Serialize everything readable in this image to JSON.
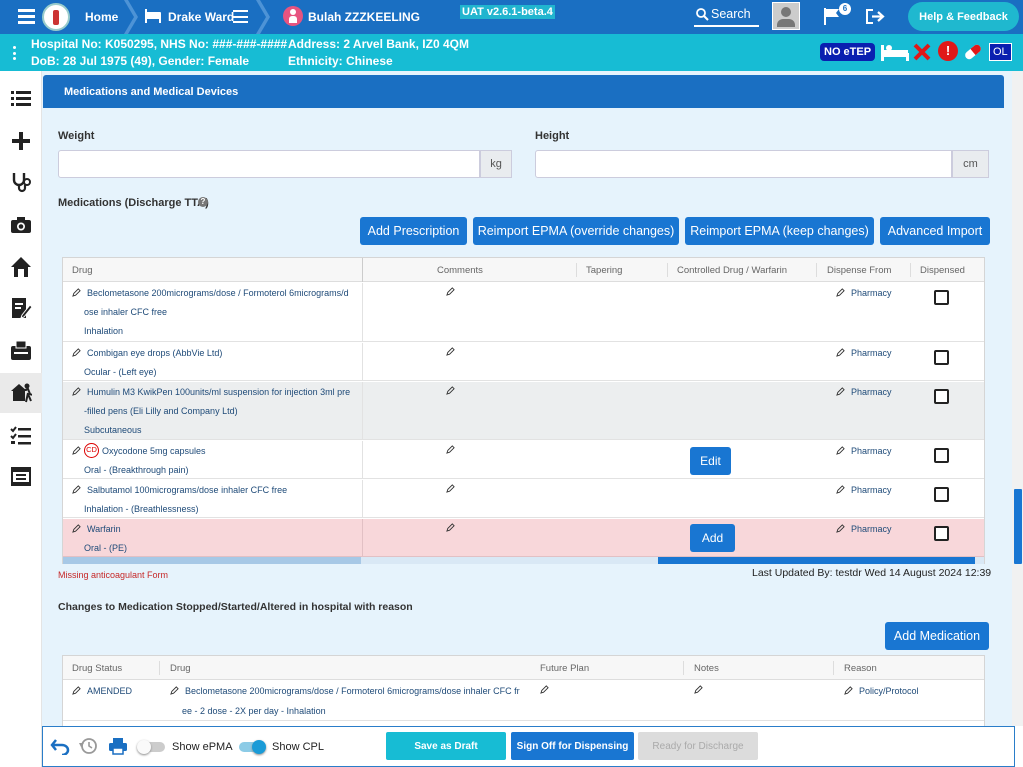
{
  "topbar": {
    "home": "Home",
    "ward": "Drake Ward",
    "patient_name": "Bulah ZZZKEELING",
    "version": "UAT v2.6.1-beta.4",
    "search": "Search",
    "flag_count": "6",
    "help": "Help & Feedback"
  },
  "patient": {
    "hospital_no": "Hospital No: K050295, NHS No: ###-###-####",
    "dob": "DoB: 28 Jul 1975 (49), Gender: Female",
    "address": "Address: 2 Arvel Bank, IZ0 4QM",
    "ethnicity": "Ethnicity: Chinese",
    "etep": "NO eTEP",
    "ol": "OL"
  },
  "section": {
    "title": "Medications and Medical Devices"
  },
  "form": {
    "weight_label": "Weight",
    "weight_unit": "kg",
    "height_label": "Height",
    "height_unit": "cm",
    "meds_title": "Medications (Discharge TTA)"
  },
  "actions": {
    "add_prescription": "Add Prescription",
    "reimport_override": "Reimport EPMA (override changes)",
    "reimport_keep": "Reimport EPMA (keep changes)",
    "advanced_import": "Advanced Import"
  },
  "med_table": {
    "headers": [
      "Drug",
      "Comments",
      "Tapering",
      "Controlled Drug / Warfarin",
      "Dispense From",
      "Dispensed"
    ],
    "rows": [
      {
        "drug": "Beclometasone 200micrograms/dose / Formoterol 6micrograms/d",
        "drug2": "ose inhaler CFC free",
        "route": "Inhalation",
        "dispense": "Pharmacy"
      },
      {
        "drug": "Combigan eye drops (AbbVie Ltd)",
        "drug2": "",
        "route": "Ocular - (Left eye)",
        "dispense": "Pharmacy"
      },
      {
        "drug": "Humulin M3 KwikPen 100units/ml suspension for injection 3ml pre",
        "drug2": "-filled pens (Eli Lilly and Company Ltd)",
        "route": "Subcutaneous",
        "dispense": "Pharmacy"
      },
      {
        "drug": "Oxycodone 5mg capsules",
        "drug2": "",
        "route": "Oral - (Breakthrough pain)",
        "dispense": "Pharmacy",
        "badge": "CD",
        "button": "Edit"
      },
      {
        "drug": "Salbutamol 100micrograms/dose inhaler CFC free",
        "drug2": "",
        "route": "Inhalation - (Breathlessness)",
        "dispense": "Pharmacy"
      },
      {
        "drug": "Warfarin",
        "drug2": "",
        "route": "Oral - (PE)",
        "dispense": "Pharmacy",
        "button": "Add"
      }
    ]
  },
  "warning": "Missing anticoagulant Form",
  "last_updated": "Last Updated By: testdr Wed 14 August 2024 12:39",
  "changes": {
    "title": "Changes to Medication Stopped/Started/Altered in hospital with reason",
    "add_medication": "Add Medication",
    "headers": [
      "Drug Status",
      "Drug",
      "Future Plan",
      "Notes",
      "Reason"
    ],
    "rows": [
      {
        "status": "AMENDED",
        "drug": "Beclometasone 200micrograms/dose / Formoterol 6micrograms/dose inhaler CFC fr",
        "drug2": "ee - 2 dose - 2X per day - Inhalation",
        "reason": "Policy/Protocol"
      }
    ]
  },
  "bottom": {
    "show_epma": "Show ePMA",
    "show_cpl": "Show CPL",
    "save_draft": "Save as Draft",
    "sign_off": "Sign Off for Dispensing",
    "ready": "Ready for Discharge"
  },
  "colors": {
    "topbar": "#1a6fc2",
    "patient_bar": "#17bcd4",
    "accent": "#1976d2",
    "warning_row": "#f8d7da"
  }
}
